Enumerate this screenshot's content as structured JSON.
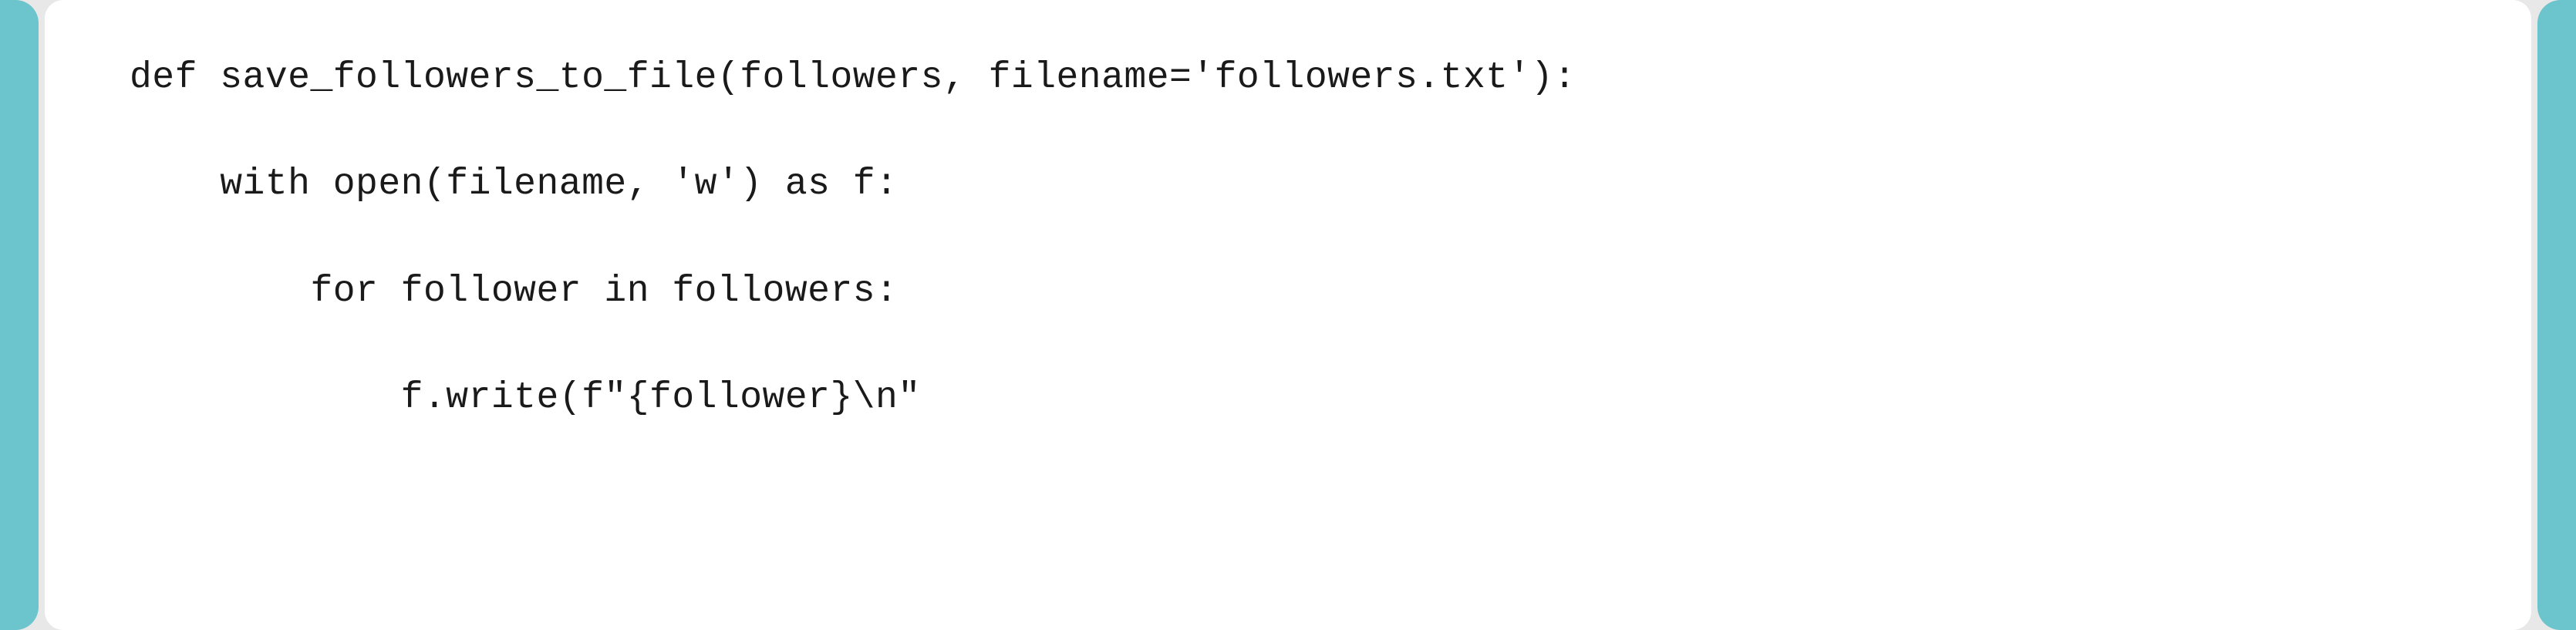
{
  "code": {
    "line1": "def save_followers_to_file(followers, filename='followers.txt'):",
    "line2": "    with open(filename, 'w') as f:",
    "line3": "        for follower in followers:",
    "line4": "            f.write(f\"{follower}\\n\""
  }
}
